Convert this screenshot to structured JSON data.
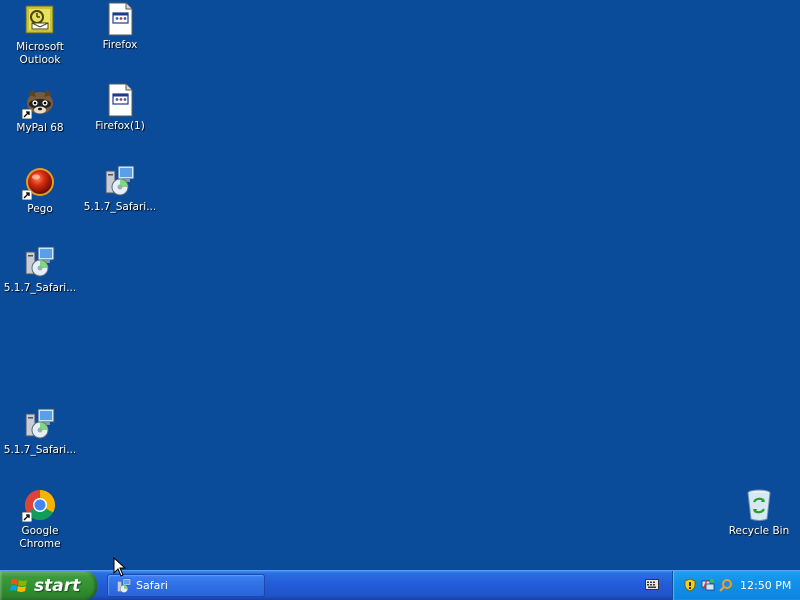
{
  "desktop": {
    "background": "#0a4c9a",
    "icons": [
      {
        "label": "Microsoft\nOutlook",
        "icon": "outlook-icon"
      },
      {
        "label": "Firefox",
        "icon": "file-icon"
      },
      {
        "label": "MyPal 68",
        "icon": "mypal-icon"
      },
      {
        "label": "Firefox(1)",
        "icon": "file-icon"
      },
      {
        "label": "Pego",
        "icon": "pego-icon"
      },
      {
        "label": "5.1.7_Safari...",
        "icon": "installer-icon"
      },
      {
        "label": "5.1.7_Safari...",
        "icon": "installer-icon"
      },
      {
        "label": "5.1.7_Safari...",
        "icon": "installer-icon"
      },
      {
        "label": "Google Chrome",
        "icon": "chrome-icon"
      },
      {
        "label": "Recycle Bin",
        "icon": "recycle-bin-icon"
      }
    ]
  },
  "taskbar": {
    "start_label": "start",
    "tasks": [
      {
        "label": "Safari",
        "icon": "installer-icon"
      }
    ],
    "tray": {
      "icons": [
        "shield-icon",
        "network-icon",
        "search-icon"
      ],
      "clock": "12:50 PM"
    }
  }
}
